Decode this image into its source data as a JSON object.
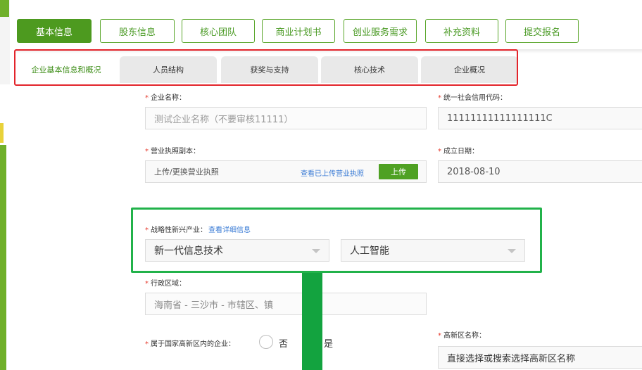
{
  "steps": [
    {
      "label": "基本信息",
      "active": true
    },
    {
      "label": "股东信息",
      "active": false
    },
    {
      "label": "核心团队",
      "active": false
    },
    {
      "label": "商业计划书",
      "active": false
    },
    {
      "label": "创业服务需求",
      "active": false
    },
    {
      "label": "补充资料",
      "active": false
    },
    {
      "label": "提交报名",
      "active": false
    }
  ],
  "subtabs": [
    {
      "label": "企业基本信息和概况",
      "active": true
    },
    {
      "label": "人员结构",
      "active": false
    },
    {
      "label": "获奖与支持",
      "active": false
    },
    {
      "label": "核心技术",
      "active": false
    },
    {
      "label": "企业概况",
      "active": false
    }
  ],
  "form": {
    "company_name": {
      "label": "企业名称：",
      "value": "测试企业名称（不要审核11111）"
    },
    "credit_code": {
      "label": "统一社会信用代码：",
      "value": "11111111111111111C"
    },
    "license": {
      "label": "营业执照副本：",
      "text": "上传/更换营业执照",
      "view_link": "查看已上传营业执照",
      "upload_button": "上传"
    },
    "found_date": {
      "label": "成立日期：",
      "value": "2018-08-10"
    },
    "industry": {
      "label": "战略性新兴产业：",
      "detail_link": "查看详细信息",
      "primary": "新一代信息技术",
      "secondary": "人工智能"
    },
    "region": {
      "label": "行政区域：",
      "value": "海南省 - 三沙市 - 市辖区、镇"
    },
    "high_tech_zone": {
      "label": "属于国家高新区内的企业：",
      "option_no": "否",
      "option_yes": "是"
    },
    "zone_name": {
      "label": "高新区名称：",
      "placeholder": "直接选择或搜索选择高新区名称"
    }
  },
  "colors": {
    "brand_green": "#4d9a1f",
    "link_blue": "#3a7bd5",
    "required_red": "#e63b2e",
    "highlight_red": "#e3242b",
    "highlight_green": "#21b24a"
  }
}
